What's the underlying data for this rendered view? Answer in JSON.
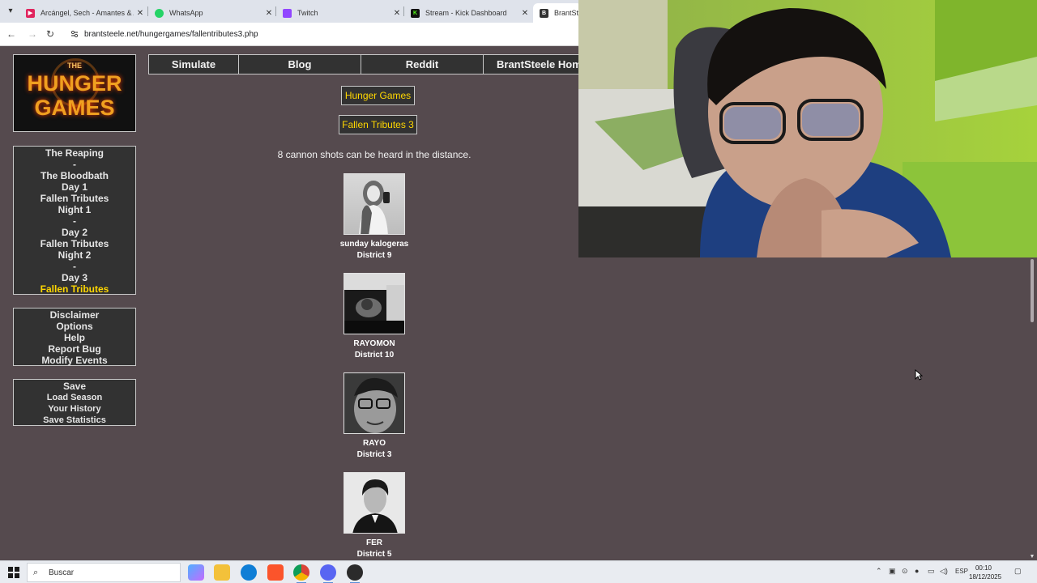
{
  "browser": {
    "tabs": [
      {
        "title": "Arcángel, Sech - Amantes & Ami",
        "color": "#e0245e",
        "glyph": "▶"
      },
      {
        "title": "WhatsApp",
        "color": "#25d366",
        "glyph": "✆"
      },
      {
        "title": "Twitch",
        "color": "#9146ff",
        "glyph": "▣"
      },
      {
        "title": "Stream - Kick Dashboard",
        "color": "#53fc18",
        "glyph": "K"
      },
      {
        "title": "BrantSteele",
        "color": "#333333",
        "glyph": "B"
      }
    ],
    "url": "brantsteele.net/hungergames/fallentributes3.php"
  },
  "logo": {
    "the": "THE",
    "hunger": "HUNGER",
    "games": "GAMES"
  },
  "top_nav": [
    "Simulate",
    "Blog",
    "Reddit",
    "BrantSteele Home"
  ],
  "sidebar": {
    "progress": [
      "The Reaping",
      "-",
      "The Bloodbath",
      "Day 1",
      "Fallen Tributes",
      "Night 1",
      "-",
      "Day 2",
      "Fallen Tributes",
      "Night 2",
      "-",
      "Day 3",
      "Fallen Tributes"
    ],
    "info": [
      "Disclaimer",
      "Options",
      "Help",
      "Report Bug",
      "Modify Events"
    ],
    "save": [
      "Save",
      "Load Season",
      "Your History",
      "Save Statistics"
    ]
  },
  "main": {
    "game_title": "Hunger Games",
    "page_title": "Fallen Tributes 3",
    "cannon_text": "8 cannon shots can be heard in the distance.",
    "tributes": [
      {
        "name": "sunday kalogeras",
        "district": "District 9"
      },
      {
        "name": "RAYOMON",
        "district": "District 10"
      },
      {
        "name": "RAYO",
        "district": "District 3"
      },
      {
        "name": "FER",
        "district": "District 5"
      }
    ]
  },
  "taskbar": {
    "search_placeholder": "Buscar",
    "language": "ESP",
    "time": "00:10",
    "date": "18/12/2025"
  }
}
